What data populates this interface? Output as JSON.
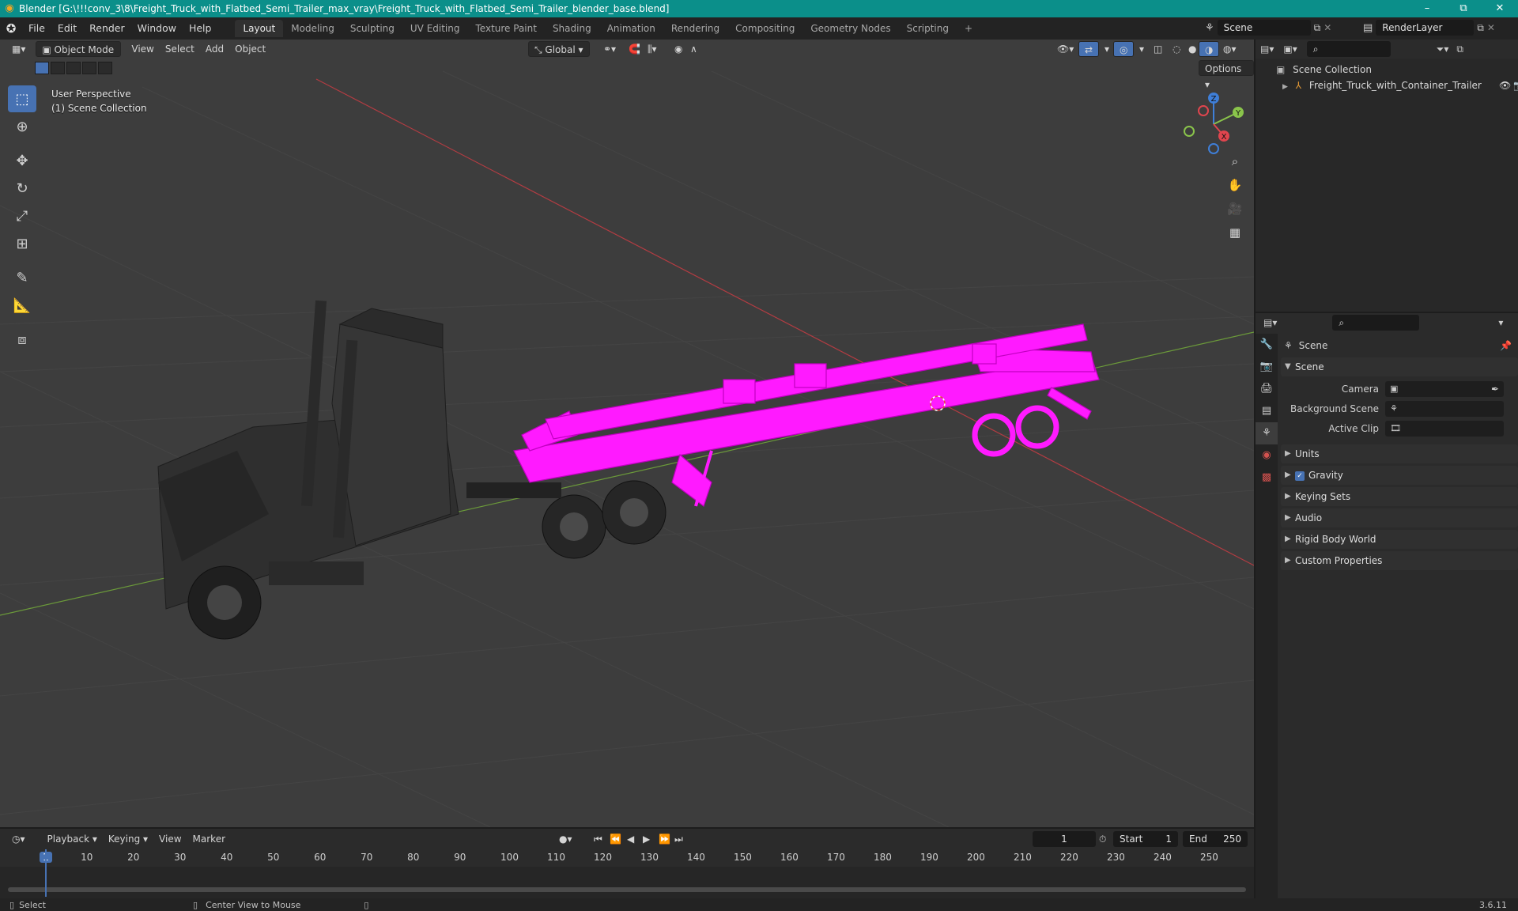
{
  "title_bar": {
    "text": "Blender [G:\\!!!conv_3\\8\\Freight_Truck_with_Flatbed_Semi_Trailer_max_vray\\Freight_Truck_with_Flatbed_Semi_Trailer_blender_base.blend]",
    "minimize": "–",
    "maximize": "⧉",
    "close": "✕"
  },
  "menu": [
    "File",
    "Edit",
    "Render",
    "Window",
    "Help"
  ],
  "workspaces": [
    "Layout",
    "Modeling",
    "Sculpting",
    "UV Editing",
    "Texture Paint",
    "Shading",
    "Animation",
    "Rendering",
    "Compositing",
    "Geometry Nodes",
    "Scripting"
  ],
  "active_workspace": "Layout",
  "add_workspace": "+",
  "scene_field": "Scene",
  "view_layer_field": "RenderLayer",
  "viewport": {
    "mode": "Object Mode",
    "menus": [
      "View",
      "Select",
      "Add",
      "Object"
    ],
    "transform_orientation": "Global",
    "options_label": "Options",
    "perspective_label": "User Perspective",
    "collection_label": "(1) Scene Collection",
    "axes": {
      "x": "X",
      "y": "Y",
      "z": "Z"
    }
  },
  "outliner": {
    "root": "Scene Collection",
    "items": [
      {
        "name": "Freight_Truck_with_Container_Trailer"
      }
    ]
  },
  "properties": {
    "header": "Scene",
    "section": "Scene",
    "fields": [
      {
        "label": "Camera",
        "value": ""
      },
      {
        "label": "Background Scene",
        "value": ""
      },
      {
        "label": "Active Clip",
        "value": ""
      }
    ],
    "panels": [
      "Units",
      "Gravity",
      "Keying Sets",
      "Audio",
      "Rigid Body World",
      "Custom Properties"
    ],
    "gravity_checked": true
  },
  "timeline": {
    "menus": [
      "Playback",
      "Keying",
      "View",
      "Marker"
    ],
    "current_frame": "1",
    "start_label": "Start",
    "start_value": "1",
    "end_label": "End",
    "end_value": "250",
    "ruler": [
      "1",
      "10",
      "20",
      "30",
      "40",
      "50",
      "60",
      "70",
      "80",
      "90",
      "100",
      "110",
      "120",
      "130",
      "140",
      "150",
      "160",
      "170",
      "180",
      "190",
      "200",
      "210",
      "220",
      "230",
      "240",
      "250"
    ]
  },
  "status_bar": {
    "select": "Select",
    "center_view": "Center View to Mouse",
    "version": "3.6.11"
  },
  "colors": {
    "title_bar": "#0b8f8a",
    "accent_blue": "#4772b3",
    "selection_magenta": "#ff1aff",
    "x_axis": "#e0454e",
    "y_axis": "#8ac44b",
    "z_axis": "#3f7fd8",
    "viewport_bg": "#3d3d3d"
  }
}
